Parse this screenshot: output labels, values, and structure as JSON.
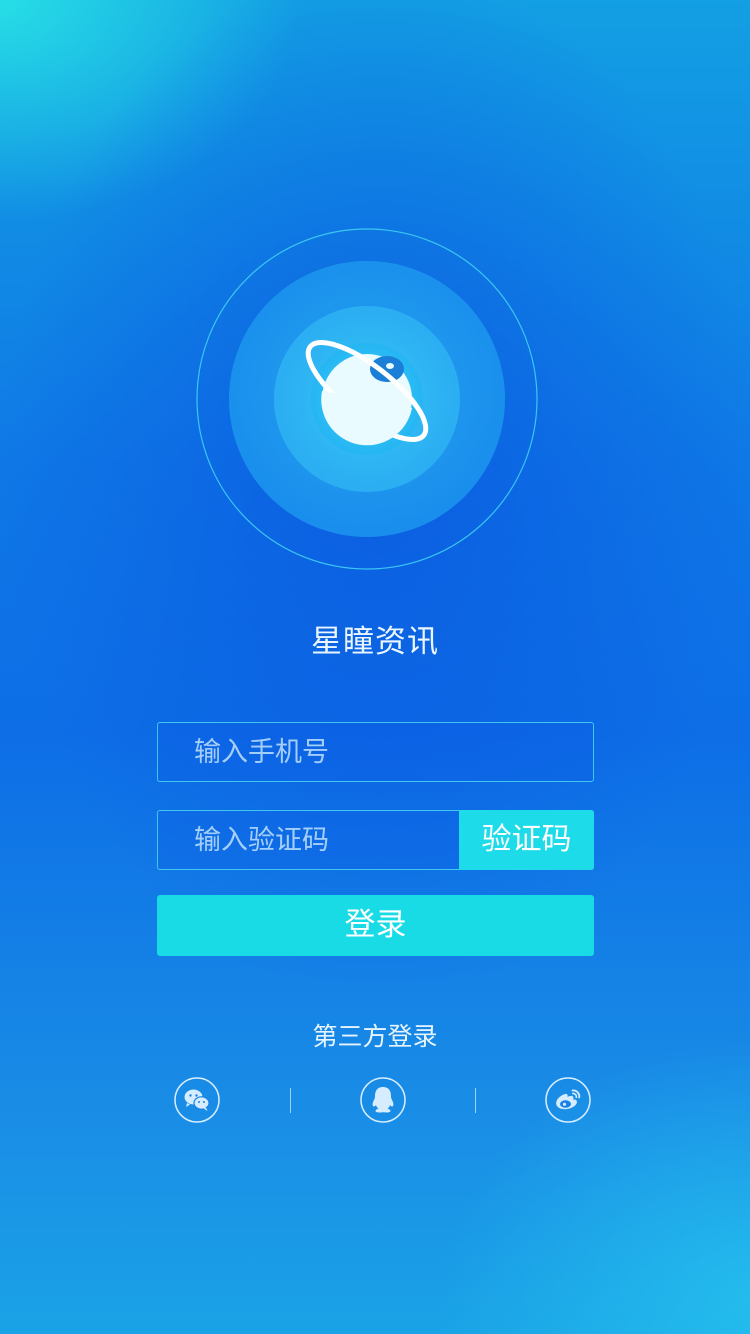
{
  "app": {
    "title": "星瞳资讯",
    "logo_icon": "planet-eye-icon"
  },
  "login_form": {
    "phone_placeholder": "输入手机号",
    "phone_value": "",
    "code_placeholder": "输入验证码",
    "code_value": "",
    "get_code_label": "验证码",
    "login_label": "登录"
  },
  "third_party": {
    "title": "第三方登录",
    "providers": [
      {
        "icon": "wechat-icon"
      },
      {
        "icon": "qq-icon"
      },
      {
        "icon": "weibo-icon"
      }
    ]
  },
  "colors": {
    "accent": "#18dbe6",
    "background": "#0d6ee6",
    "input_border": "#46d2f0"
  }
}
